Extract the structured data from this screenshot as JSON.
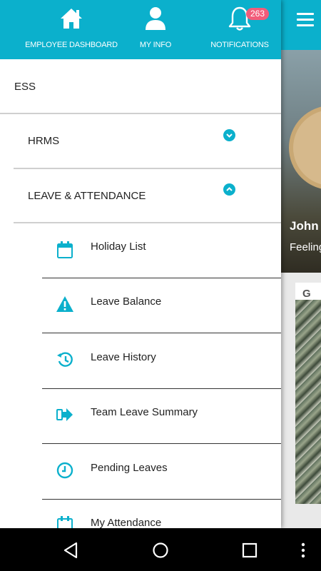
{
  "drawer": {
    "header": {
      "items": [
        {
          "label": "EMPLOYEE DASHBOARD",
          "icon": "home-icon"
        },
        {
          "label": "MY INFO",
          "icon": "user-icon"
        },
        {
          "label": "NOTIFICATIONS",
          "icon": "bell-icon",
          "badge": "263"
        }
      ]
    },
    "menu": {
      "ess": "ESS",
      "hrms": "HRMS",
      "leave_attendance": "LEAVE & ATTENDANCE",
      "sub_items": [
        {
          "label": "Holiday List",
          "icon": "calendar-icon"
        },
        {
          "label": "Leave Balance",
          "icon": "warning-icon"
        },
        {
          "label": "Leave History",
          "icon": "history-icon"
        },
        {
          "label": "Team Leave Summary",
          "icon": "arrow-right-icon"
        },
        {
          "label": "Pending Leaves",
          "icon": "clock-icon"
        },
        {
          "label": "My Attendance",
          "icon": "calendar-check-icon"
        }
      ]
    }
  },
  "background": {
    "profile_name": "John",
    "profile_status": "Feeling",
    "post_title_initial": "G"
  },
  "colors": {
    "accent": "#0bb0cc",
    "badge": "#f25c7a"
  }
}
